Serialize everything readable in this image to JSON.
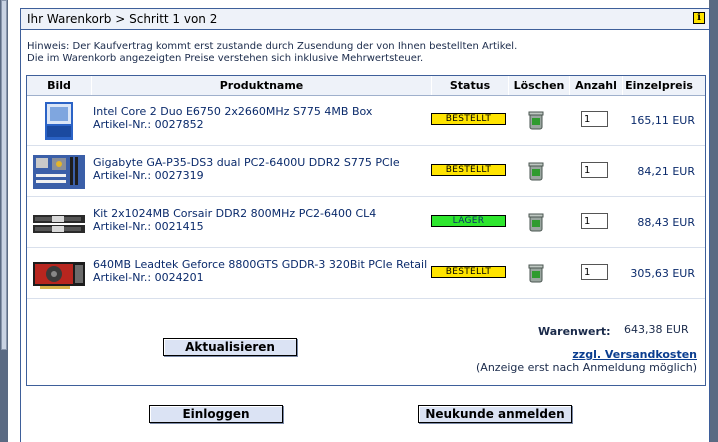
{
  "header": {
    "title": "Ihr Warenkorb > Schritt 1 von 2"
  },
  "hint": {
    "line1": "Hinweis: Der Kaufvertrag kommt erst zustande durch Zusendung der von Ihnen bestellten Artikel.",
    "line2": "Die im Warenkorb angezeigten Preise verstehen sich inklusive Mehrwertsteuer."
  },
  "table": {
    "headers": {
      "bild": "Bild",
      "name": "Produktname",
      "status": "Status",
      "delete": "Löschen",
      "qty": "Anzahl",
      "price": "Einzelpreis"
    },
    "rows": [
      {
        "name": "Intel Core 2 Duo E6750 2x2660MHz S775 4MB Box",
        "nr": "Artikel-Nr.: 0027852",
        "status": "BESTELLT",
        "status_color": "#ffe400",
        "qty": "1",
        "price": "165,11 EUR",
        "image": "cpu-box-image"
      },
      {
        "name": "Gigabyte GA-P35-DS3 dual PC2-6400U DDR2 S775 PCIe",
        "nr": "Artikel-Nr.: 0027319",
        "status": "BESTELLT",
        "status_color": "#ffe400",
        "qty": "1",
        "price": "84,21 EUR",
        "image": "motherboard-image"
      },
      {
        "name": "Kit 2x1024MB Corsair DDR2 800MHz PC2-6400 CL4",
        "nr": "Artikel-Nr.: 0021415",
        "status": "LAGER",
        "status_color": "#2ee62e",
        "qty": "1",
        "price": "88,43 EUR",
        "image": "ram-kit-image"
      },
      {
        "name": "640MB Leadtek Geforce 8800GTS GDDR-3 320Bit PCIe Retail",
        "nr": "Artikel-Nr.: 0024201",
        "status": "BESTELLT",
        "status_color": "#ffe400",
        "qty": "1",
        "price": "305,63 EUR",
        "image": "graphics-card-image"
      }
    ]
  },
  "summary": {
    "label": "Warenwert:",
    "value": "643,38 EUR",
    "shipping_link": "zzgl. Versandkosten",
    "shipping_note": "(Anzeige erst nach Anmeldung möglich)"
  },
  "buttons": {
    "update": "Aktualisieren",
    "login": "Einloggen",
    "register": "Neukunde anmelden"
  },
  "icons": {
    "info": "info-icon",
    "delete": "trash-icon"
  },
  "colors": {
    "border": "#3e5f9a",
    "header_bg": "#eef2f9",
    "link": "#0a3d8f",
    "status_bestellt": "#ffe400",
    "status_lager": "#2ee62e"
  }
}
